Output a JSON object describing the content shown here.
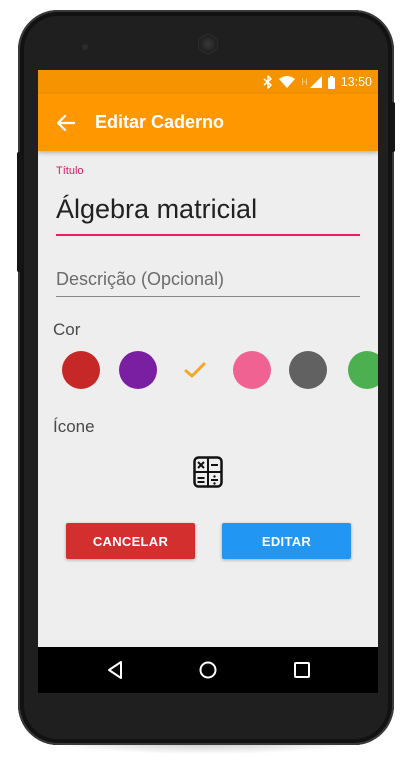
{
  "statusbar": {
    "time": "13:50",
    "network_indicator": "H",
    "icons": [
      "bluetooth-icon",
      "wifi-icon",
      "signal-icon",
      "battery-icon"
    ],
    "color": "#f59300"
  },
  "appbar": {
    "title": "Editar Caderno",
    "back_icon": "arrow-back-icon",
    "color": "#ff9800"
  },
  "form": {
    "title_label": "Título",
    "title_value": "Álgebra matricial",
    "description_placeholder": "Descrição (Opcional)",
    "description_value": "",
    "color_label": "Cor",
    "icon_label": "Ícone",
    "selected_icon": "calculator-icon"
  },
  "colors": {
    "selected_index": 2,
    "options": [
      {
        "name": "red",
        "hex": "#c62828"
      },
      {
        "name": "purple",
        "hex": "#7b1fa2"
      },
      {
        "name": "orange",
        "hex": "#f5a623"
      },
      {
        "name": "pink",
        "hex": "#f06292"
      },
      {
        "name": "gray",
        "hex": "#616161"
      },
      {
        "name": "green",
        "hex": "#4caf50"
      }
    ]
  },
  "buttons": {
    "cancel_label": "CANCELAR",
    "edit_label": "EDITAR",
    "cancel_color": "#d32f2f",
    "edit_color": "#2196f3"
  },
  "navbar": {
    "icons": [
      "nav-back-icon",
      "nav-home-icon",
      "nav-recents-icon"
    ]
  }
}
